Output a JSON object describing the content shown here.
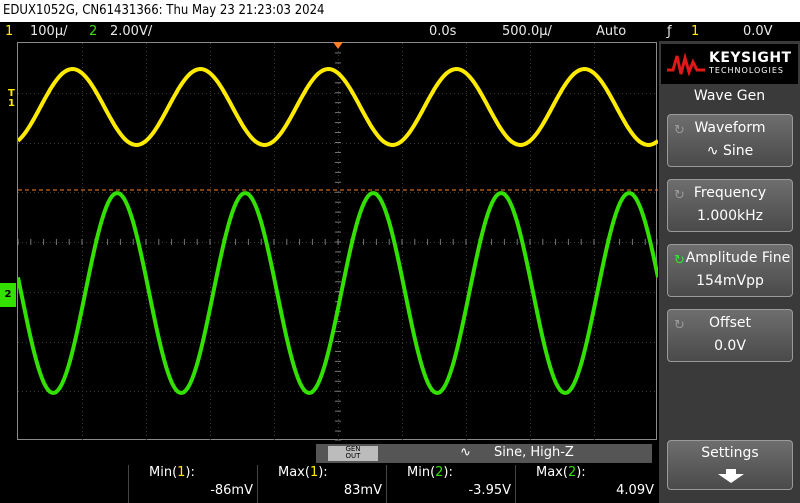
{
  "title_bar": "EDUX1052G, CN61431366: Thu May 23 21:23:03 2024",
  "status": {
    "ch1_num": "1",
    "ch1_scale": "100&/",
    "ch2_num": "2",
    "ch2_scale": "2.00V/",
    "delay": "0.0s",
    "timebase": "500.0&/",
    "trigger_mode": "Auto",
    "trigger_slope_icon": "rising-edge-icon",
    "trigger_slope": "ƒ",
    "trigger_ch": "1",
    "trigger_level": "0.0V"
  },
  "markers": {
    "trigger": "T",
    "ch1": "1",
    "ch2": "2"
  },
  "logo": {
    "name": "KEYSIGHT",
    "sub": "TECHNOLOGIES"
  },
  "menu": {
    "title": "Wave Gen",
    "keys": [
      {
        "label": "Waveform",
        "value": "∿ Sine",
        "icon": "rotary-knob-icon",
        "active": false
      },
      {
        "label": "Frequency",
        "value": "1.000kHz",
        "icon": "rotary-knob-icon",
        "active": false
      },
      {
        "label": "Amplitude Fine",
        "value": "154mVpp",
        "icon": "rotary-knob-icon",
        "active": true
      },
      {
        "label": "Offset",
        "value": "0.0V",
        "icon": "rotary-knob-icon",
        "active": false
      }
    ],
    "settings": "Settings"
  },
  "wavegen_bar": {
    "button_line1": "GEN",
    "button_line2": "OUT",
    "text": "Sine, High-Z",
    "icon": "sine-wave-icon"
  },
  "measurements": [
    {
      "name": "Min(",
      "ch": "1",
      "end": "):",
      "value": "-86mV"
    },
    {
      "name": "Max(",
      "ch": "1",
      "end": "):",
      "value": "83mV"
    },
    {
      "name": "Min(",
      "ch": "2",
      "end": "):",
      "value": "-3.95V"
    },
    {
      "name": "Max(",
      "ch": "2",
      "end": "):",
      "value": "4.09V"
    }
  ],
  "colors": {
    "ch1": "#ffeb00",
    "ch2": "#33e000",
    "trigger_line": "#ff7f2a"
  }
}
